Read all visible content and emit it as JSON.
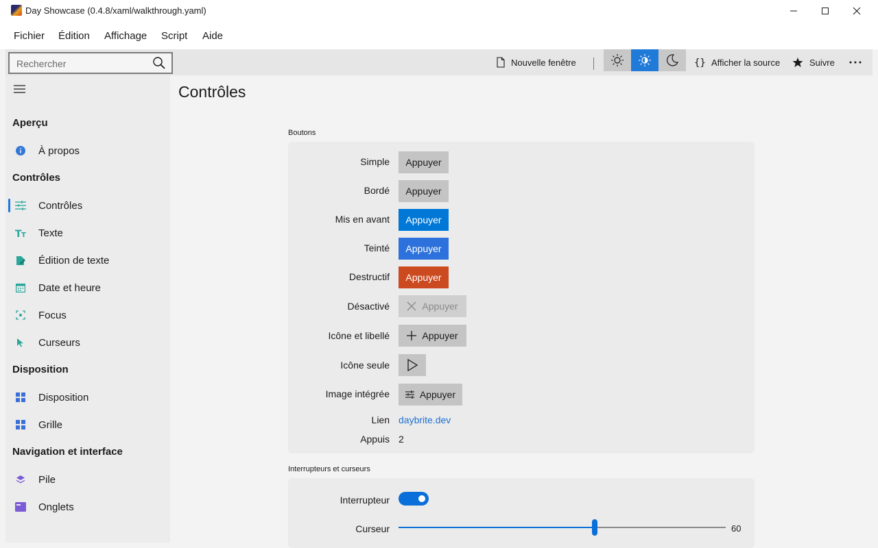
{
  "window": {
    "title": "Day Showcase (0.4.8/xaml/walkthrough.yaml)"
  },
  "menu": [
    "Fichier",
    "Édition",
    "Affichage",
    "Script",
    "Aide"
  ],
  "toolbar": {
    "search_placeholder": "Rechercher",
    "new_window": "Nouvelle fenêtre",
    "show_source": "Afficher la source",
    "follow": "Suivre",
    "active_theme": "contrast",
    "accent_color": "#1f7ad8"
  },
  "sidebar": {
    "groups": [
      {
        "title": "Aperçu",
        "items": [
          {
            "label": "À propos",
            "icon": "info-icon"
          }
        ]
      },
      {
        "title": "Contrôles",
        "items": [
          {
            "label": "Contrôles",
            "icon": "sliders-icon",
            "active": true
          },
          {
            "label": "Texte",
            "icon": "text-size-icon"
          },
          {
            "label": "Édition de texte",
            "icon": "edit-document-icon"
          },
          {
            "label": "Date et heure",
            "icon": "calendar-icon"
          },
          {
            "label": "Focus",
            "icon": "focus-icon"
          },
          {
            "label": "Curseurs",
            "icon": "cursor-icon"
          }
        ]
      },
      {
        "title": "Disposition",
        "items": [
          {
            "label": "Disposition",
            "icon": "layout-icon"
          },
          {
            "label": "Grille",
            "icon": "grid-icon"
          }
        ]
      },
      {
        "title": "Navigation et interface",
        "items": [
          {
            "label": "Pile",
            "icon": "stack-icon"
          },
          {
            "label": "Onglets",
            "icon": "tabs-icon"
          }
        ]
      }
    ]
  },
  "page": {
    "title": "Contrôles",
    "buttons_section": {
      "label": "Boutons",
      "rows": [
        {
          "label": "Simple",
          "button": "Appuyer"
        },
        {
          "label": "Bordé",
          "button": "Appuyer"
        },
        {
          "label": "Mis en avant",
          "button": "Appuyer"
        },
        {
          "label": "Teinté",
          "button": "Appuyer"
        },
        {
          "label": "Destructif",
          "button": "Appuyer"
        },
        {
          "label": "Désactivé",
          "button": "Appuyer"
        },
        {
          "label": "Icône et libellé",
          "button": "Appuyer"
        },
        {
          "label": "Icône seule",
          "button": ""
        },
        {
          "label": "Image intégrée",
          "button": "Appuyer"
        }
      ],
      "link_label": "Lien",
      "link_text": "daybrite.dev",
      "presses_label": "Appuis",
      "presses_value": "2"
    },
    "switches_section": {
      "label": "Interrupteurs et curseurs",
      "toggle_label": "Interrupteur",
      "toggle_on": true,
      "slider_label": "Curseur",
      "slider_value": "60",
      "slider_max": 100
    }
  }
}
